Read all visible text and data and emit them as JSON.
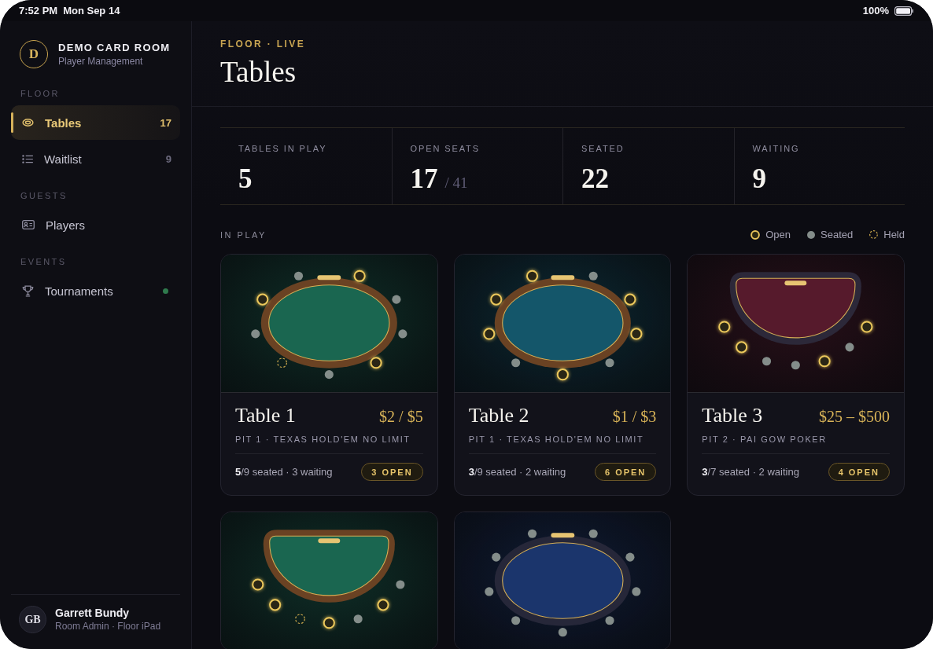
{
  "status_bar": {
    "time": "7:52 PM",
    "date": "Mon Sep 14",
    "battery": "100%"
  },
  "sidebar": {
    "brand": {
      "monogram": "D",
      "name": "DEMO CARD ROOM",
      "subtitle": "Player Management"
    },
    "sections": [
      {
        "title": "FLOOR",
        "items": [
          {
            "label": "Tables",
            "count": "17",
            "selected": true,
            "live": false
          },
          {
            "label": "Waitlist",
            "count": "9",
            "selected": false,
            "live": false
          }
        ]
      },
      {
        "title": "GUESTS",
        "items": [
          {
            "label": "Players",
            "selected": false,
            "live": false
          }
        ]
      },
      {
        "title": "EVENTS",
        "items": [
          {
            "label": "Tournaments",
            "selected": false,
            "live": true
          }
        ]
      }
    ],
    "user": {
      "initials": "GB",
      "name": "Garrett Bundy",
      "role": "Room Admin · Floor iPad"
    }
  },
  "header": {
    "eyebrow": "FLOOR · LIVE",
    "title": "Tables"
  },
  "stats": [
    {
      "label": "TABLES IN PLAY",
      "value": "5"
    },
    {
      "label": "OPEN SEATS",
      "value": "17",
      "total": "/ 41"
    },
    {
      "label": "SEATED",
      "value": "22"
    },
    {
      "label": "WAITING",
      "value": "9"
    }
  ],
  "in_play": {
    "title": "IN PLAY",
    "legend": [
      {
        "label": "Open",
        "kind": "open"
      },
      {
        "label": "Seated",
        "kind": "seated"
      },
      {
        "label": "Held",
        "kind": "held"
      }
    ]
  },
  "tables": [
    {
      "name": "Table 1",
      "stakes": "$2 / $5",
      "game": "PIT 1 · TEXAS HOLD'EM NO LIMIT",
      "summary": "**5**/9 seated · 3 waiting",
      "badge": "3 OPEN",
      "kind": "oval",
      "rail": {
        "color": "#6a4223"
      },
      "color": "#1a6650",
      "seats": [
        {
          "kind": "seated"
        },
        {
          "kind": "open"
        },
        {
          "kind": "seated"
        },
        {
          "kind": "seated"
        },
        {
          "kind": "open"
        },
        {
          "kind": "seated"
        },
        {
          "kind": "held"
        },
        {
          "kind": "seated"
        },
        {
          "kind": "open"
        }
      ]
    },
    {
      "name": "Table 2",
      "stakes": "$1 / $3",
      "game": "PIT 1 · TEXAS HOLD'EM NO LIMIT",
      "summary": "**3**/9 seated · 2 waiting",
      "badge": "6 OPEN",
      "kind": "oval",
      "rail": {
        "color": "#6a4223"
      },
      "color": "#14566a",
      "seats": [
        {
          "kind": "open"
        },
        {
          "kind": "seated"
        },
        {
          "kind": "open"
        },
        {
          "kind": "open"
        },
        {
          "kind": "seated"
        },
        {
          "kind": "open"
        },
        {
          "kind": "seated"
        },
        {
          "kind": "open"
        },
        {
          "kind": "open"
        }
      ]
    },
    {
      "name": "Table 3",
      "stakes": "$25 – $500",
      "game": "PIT 2 · PAI GOW POKER",
      "summary": "**3**/7 seated · 2 waiting",
      "badge": "4 OPEN",
      "kind": "half",
      "rail": {
        "color": "#2c2839"
      },
      "color": "#561a2c",
      "seats": [
        {
          "kind": "open"
        },
        {
          "kind": "open"
        },
        {
          "kind": "seated"
        },
        {
          "kind": "seated"
        },
        {
          "kind": "open"
        },
        {
          "kind": "seated"
        },
        {
          "kind": "open"
        }
      ]
    },
    {
      "kind": "half",
      "rail": {
        "color": "#6a4223"
      },
      "color": "#1a6650",
      "seats": [
        {
          "kind": "open"
        },
        {
          "kind": "open"
        },
        {
          "kind": "held"
        },
        {
          "kind": "open"
        },
        {
          "kind": "seated"
        },
        {
          "kind": "open"
        },
        {
          "kind": "seated"
        }
      ]
    },
    {
      "kind": "oval",
      "rail": {
        "color": "#262739"
      },
      "color": "#1b356c",
      "seats": [
        {
          "kind": "seated"
        },
        {
          "kind": "seated"
        },
        {
          "kind": "seated"
        },
        {
          "kind": "seated"
        },
        {
          "kind": "seated"
        },
        {
          "kind": "seated"
        },
        {
          "kind": "seated"
        },
        {
          "kind": "seated"
        },
        {
          "kind": "seated"
        }
      ]
    }
  ]
}
